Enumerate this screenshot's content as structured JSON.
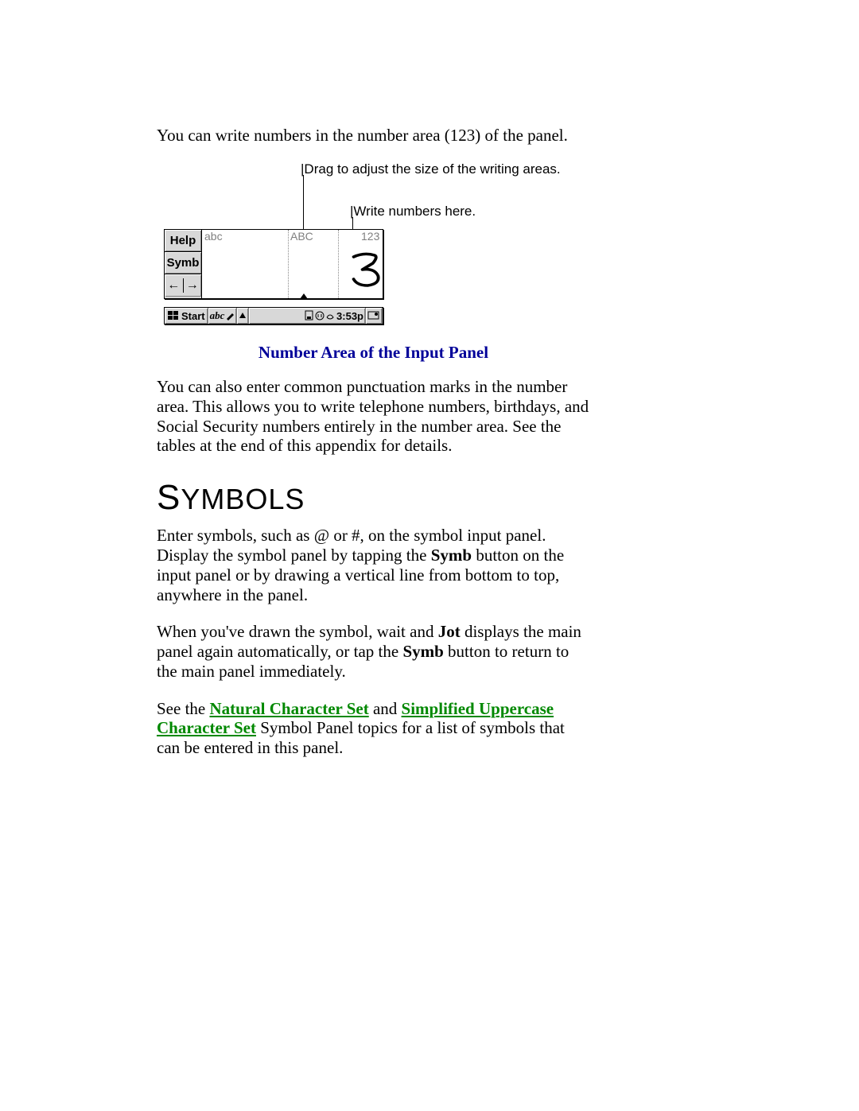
{
  "intro": "You can write numbers in the number area (123) of the panel.",
  "figure": {
    "callout_drag": "Drag to adjust the size of the writing areas.",
    "callout_write": "Write numbers here.",
    "panel": {
      "help": "Help",
      "symb": "Symb",
      "area_abc_lower": "abc",
      "area_abc_upper": "ABC",
      "area_123": "123",
      "handwritten": "3"
    },
    "taskbar": {
      "start": "Start",
      "mode": "abc",
      "time": "3:53p"
    },
    "caption": "Number Area of the Input Panel"
  },
  "para_punct": "You can also enter common punctuation marks in the number area. This allows you to write telephone numbers, birthdays, and Social Security numbers entirely in the number area. See the tables at the end of this appendix for details.",
  "heading_symbols_first": "S",
  "heading_symbols_rest": "YMBOLS",
  "symbols_p1_a": "Enter symbols, such as @ or #, on the symbol input panel. Display the symbol panel by tapping the ",
  "symbols_p1_bold1": "Symb",
  "symbols_p1_b": " button on the input panel or by drawing a vertical line from bottom to top, anywhere in the panel.",
  "symbols_p2_a": "When you've drawn the symbol, wait and ",
  "symbols_p2_bold1": "Jot",
  "symbols_p2_b": " displays the main panel again automatically, or tap the ",
  "symbols_p2_bold2": "Symb",
  "symbols_p2_c": " button to return to the main panel immediately.",
  "symbols_p3_a": "See the ",
  "symbols_p3_link1": "Natural Character Set",
  "symbols_p3_b": " and ",
  "symbols_p3_link2": "Simplified Uppercase Character Set",
  "symbols_p3_c": " Symbol Panel topics for a list of symbols that can be entered in this panel."
}
